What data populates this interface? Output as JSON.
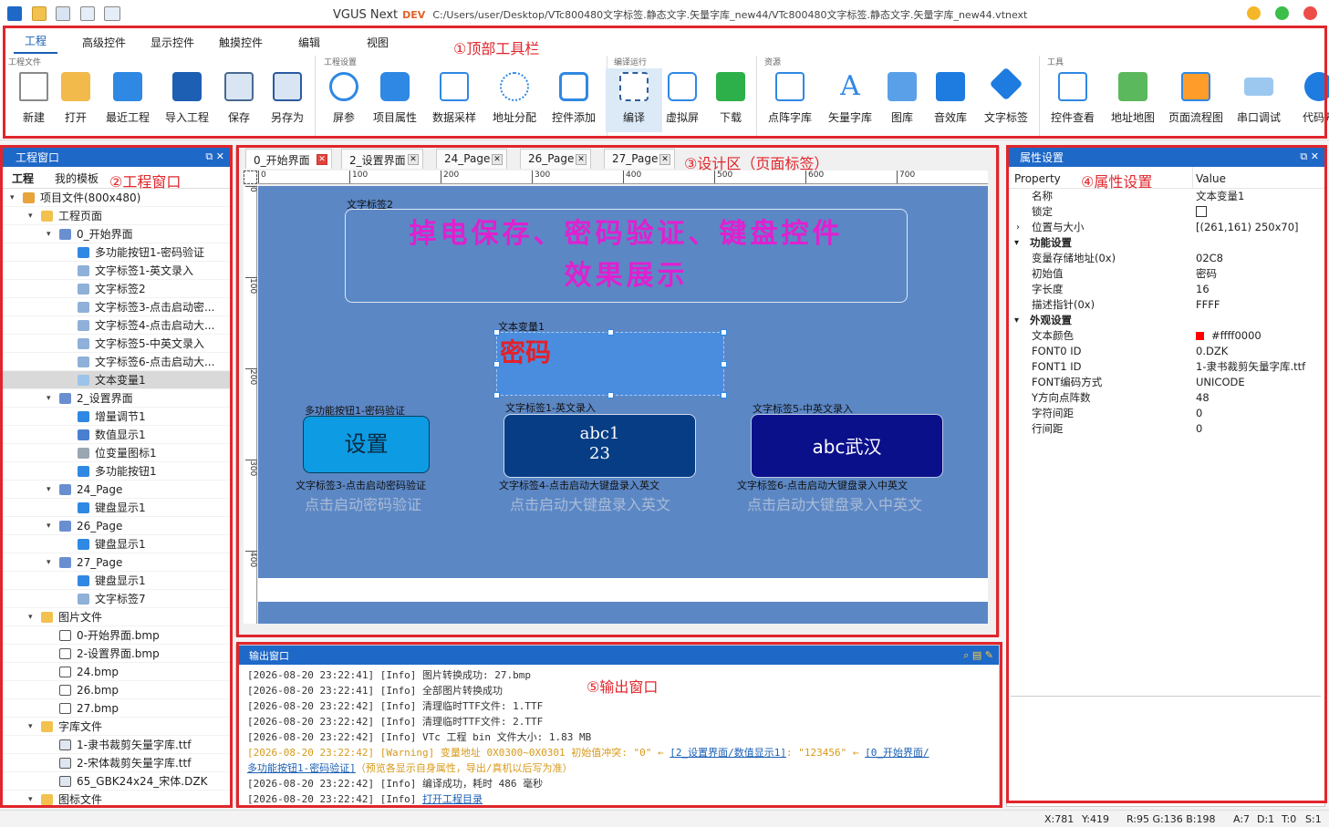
{
  "titlebar": {
    "app_name": "VGUS Next",
    "dev_badge": "DEV",
    "path": "C:/Users/user/Desktop/VTc800480文字标签.静态文字.矢量字库_new44/VTc800480文字标签.静态文字.矢量字库_new44.vtnext",
    "quick_icons": [
      "app-icon",
      "open-folder-icon",
      "save-icon",
      "build-icon",
      "preview-icon"
    ]
  },
  "ribbon": {
    "tabs": [
      "工程",
      "高级控件",
      "显示控件",
      "触摸控件",
      "编辑",
      "视图"
    ],
    "active_tab": "工程",
    "groups": [
      {
        "title": "工程文件",
        "tools": [
          "新建",
          "打开",
          "最近工程",
          "导入工程",
          "保存",
          "另存为"
        ]
      },
      {
        "title": "工程设置",
        "tools": [
          "屏参",
          "项目属性",
          "数据采样",
          "地址分配",
          "控件添加"
        ]
      },
      {
        "title": "编译运行",
        "tools": [
          "编译",
          "虚拟屏",
          "下载"
        ]
      },
      {
        "title": "资源",
        "tools": [
          "点阵字库",
          "矢量字库",
          "图库",
          "音效库",
          "文字标签"
        ]
      },
      {
        "title": "工具",
        "tools": [
          "控件查看",
          "地址地图",
          "页面流程图",
          "串口调试",
          "代码开"
        ]
      }
    ]
  },
  "annotations": {
    "toolbar": "①顶部工具栏",
    "project": "②工程窗口",
    "design": "③设计区（页面标签）",
    "props": "④属性设置",
    "output": "⑤输出窗口"
  },
  "project_panel": {
    "title": "工程窗口",
    "tabs": [
      "工程",
      "我的模板"
    ],
    "tree": [
      {
        "level": 0,
        "toggle": "▾",
        "icon": "project",
        "label": "项目文件(800x480)"
      },
      {
        "level": 1,
        "toggle": "▾",
        "icon": "folder",
        "label": "工程页面"
      },
      {
        "level": 2,
        "toggle": "▾",
        "icon": "page",
        "label": "0_开始界面"
      },
      {
        "level": 3,
        "toggle": "",
        "icon": "button",
        "label": "多功能按钮1-密码验证"
      },
      {
        "level": 3,
        "toggle": "",
        "icon": "text",
        "label": "文字标签1-英文录入"
      },
      {
        "level": 3,
        "toggle": "",
        "icon": "text",
        "label": "文字标签2"
      },
      {
        "level": 3,
        "toggle": "",
        "icon": "text",
        "label": "文字标签3-点击启动密..."
      },
      {
        "level": 3,
        "toggle": "",
        "icon": "text",
        "label": "文字标签4-点击启动大..."
      },
      {
        "level": 3,
        "toggle": "",
        "icon": "text",
        "label": "文字标签5-中英文录入"
      },
      {
        "level": 3,
        "toggle": "",
        "icon": "text",
        "label": "文字标签6-点击启动大..."
      },
      {
        "level": 3,
        "toggle": "",
        "icon": "var",
        "label": "文本变量1",
        "selected": true
      },
      {
        "level": 2,
        "toggle": "▾",
        "icon": "page",
        "label": "2_设置界面"
      },
      {
        "level": 3,
        "toggle": "",
        "icon": "inc",
        "label": "增量调节1"
      },
      {
        "level": 3,
        "toggle": "",
        "icon": "num",
        "label": "数值显示1"
      },
      {
        "level": 3,
        "toggle": "",
        "icon": "bit",
        "label": "位变量图标1"
      },
      {
        "level": 3,
        "toggle": "",
        "icon": "button",
        "label": "多功能按钮1"
      },
      {
        "level": 2,
        "toggle": "▾",
        "icon": "page",
        "label": "24_Page"
      },
      {
        "level": 3,
        "toggle": "",
        "icon": "kbd",
        "label": "键盘显示1"
      },
      {
        "level": 2,
        "toggle": "▾",
        "icon": "page",
        "label": "26_Page"
      },
      {
        "level": 3,
        "toggle": "",
        "icon": "kbd",
        "label": "键盘显示1"
      },
      {
        "level": 2,
        "toggle": "▾",
        "icon": "page",
        "label": "27_Page"
      },
      {
        "level": 3,
        "toggle": "",
        "icon": "kbd",
        "label": "键盘显示1"
      },
      {
        "level": 3,
        "toggle": "",
        "icon": "text",
        "label": "文字标签7"
      },
      {
        "level": 1,
        "toggle": "▾",
        "icon": "folder",
        "label": "图片文件"
      },
      {
        "level": 2,
        "toggle": "",
        "icon": "file",
        "label": "0-开始界面.bmp"
      },
      {
        "level": 2,
        "toggle": "",
        "icon": "file",
        "label": "2-设置界面.bmp"
      },
      {
        "level": 2,
        "toggle": "",
        "icon": "file",
        "label": "24.bmp"
      },
      {
        "level": 2,
        "toggle": "",
        "icon": "file",
        "label": "26.bmp"
      },
      {
        "level": 2,
        "toggle": "",
        "icon": "file",
        "label": "27.bmp"
      },
      {
        "level": 1,
        "toggle": "▾",
        "icon": "folder",
        "label": "字库文件"
      },
      {
        "level": 2,
        "toggle": "",
        "icon": "font",
        "label": "1-隶书裁剪矢量字库.ttf"
      },
      {
        "level": 2,
        "toggle": "",
        "icon": "font",
        "label": "2-宋体裁剪矢量字库.ttf"
      },
      {
        "level": 2,
        "toggle": "",
        "icon": "font",
        "label": "65_GBK24x24_宋体.DZK"
      },
      {
        "level": 1,
        "toggle": "▾",
        "icon": "folder",
        "label": "图标文件"
      }
    ]
  },
  "design": {
    "tabs": [
      "0_开始界面",
      "2_设置界面",
      "24_Page",
      "26_Page",
      "27_Page"
    ],
    "active_tab": "0_开始界面",
    "ruler_ticks": [
      "0",
      "100",
      "200",
      "300",
      "400",
      "500",
      "600",
      "700"
    ],
    "vruler_ticks": [
      "0",
      "100",
      "200",
      "300",
      "400"
    ],
    "canvas_color": "#5b87c5",
    "widgets": {
      "label2_name": "文字标签2",
      "label2_line1": "掉电保存、密码验证、键盘控件",
      "label2_line2": "效果展示",
      "var1_name": "文本变量1",
      "var1_text": "密码",
      "btn1_name": "多功能按钮1-密码验证",
      "btn1_text": "设置",
      "lbl1_name": "文字标签1-英文录入",
      "lbl1_line1": "abc1",
      "lbl1_line2": "23",
      "lbl5_name": "文字标签5-中英文录入",
      "lbl5_text": "abc武汉",
      "lbl3_name": "文字标签3-点击启动密码验证",
      "lbl3_text": "点击启动密码验证",
      "lbl4_name": "文字标签4-点击启动大键盘录入英文",
      "lbl4_text": "点击启动大键盘录入英文",
      "lbl6_name": "文字标签6-点击启动大键盘录入中英文",
      "lbl6_text": "点击启动大键盘录入中英文"
    }
  },
  "output": {
    "title": "输出窗口",
    "lines": [
      {
        "type": "info",
        "text": "[2026-08-20 23:22:41] [Info] 图片转换成功: 27.bmp"
      },
      {
        "type": "info",
        "text": "[2026-08-20 23:22:41] [Info] 全部图片转换成功"
      },
      {
        "type": "info",
        "text": "[2026-08-20 23:22:42] [Info] 清理临时TTF文件: 1.TTF"
      },
      {
        "type": "info",
        "text": "[2026-08-20 23:22:42] [Info] 清理临时TTF文件: 2.TTF"
      },
      {
        "type": "info",
        "text": "[2026-08-20 23:22:42] [Info] VTc 工程 bin 文件大小: 1.83 MB"
      }
    ],
    "warn_prefix": "[2026-08-20 23:22:42] [Warning] 变量地址 0X0300~0X0301 初始值冲突: \"0\" ← ",
    "warn_link1": "[2_设置界面/数值显示1]",
    "warn_mid": ": \"123456\" ← ",
    "warn_link2": "[0_开始界面/",
    "warn_cont_link": "多功能按钮1-密码验证]",
    "warn_cont_text": "（预览各显示自身属性，导出/真机以后写为准）",
    "done_line": "[2026-08-20 23:22:42] [Info] 编译成功，耗时 486 毫秒",
    "last_prefix": "[2026-08-20 23:22:42] [Info] ",
    "last_link": "打开工程目录"
  },
  "props": {
    "title": "属性设置",
    "col_property": "Property",
    "col_value": "Value",
    "rows": [
      {
        "type": "prop",
        "name": "名称",
        "value": "文本变量1"
      },
      {
        "type": "prop",
        "name": "锁定",
        "value": "",
        "checkbox": true
      },
      {
        "type": "prop",
        "name": "位置与大小",
        "value": "[(261,161) 250x70]",
        "expander": "›"
      },
      {
        "type": "cat",
        "name": "功能设置",
        "expander": "▾"
      },
      {
        "type": "prop",
        "name": "变量存储地址(0x)",
        "value": "02C8"
      },
      {
        "type": "prop",
        "name": "初始值",
        "value": "密码"
      },
      {
        "type": "prop",
        "name": "字长度",
        "value": "16"
      },
      {
        "type": "prop",
        "name": "描述指针(0x)",
        "value": "FFFF"
      },
      {
        "type": "cat",
        "name": "外观设置",
        "expander": "▾"
      },
      {
        "type": "prop",
        "name": "文本颜色",
        "value": "#ffff0000",
        "swatch": "#ff0000"
      },
      {
        "type": "prop",
        "name": "FONT0 ID",
        "value": "0.DZK"
      },
      {
        "type": "prop",
        "name": "FONT1 ID",
        "value": "1-隶书裁剪矢量字库.ttf"
      },
      {
        "type": "prop",
        "name": "FONT编码方式",
        "value": "UNICODE"
      },
      {
        "type": "prop",
        "name": "Y方向点阵数",
        "value": "48"
      },
      {
        "type": "prop",
        "name": "字符间距",
        "value": "0"
      },
      {
        "type": "prop",
        "name": "行间距",
        "value": "0"
      }
    ]
  },
  "status": {
    "x": "X:781",
    "y": "Y:419",
    "rgb": "R:95 G:136 B:198",
    "a": "A:7",
    "d": "D:1",
    "t": "T:0",
    "s": "S:1"
  }
}
